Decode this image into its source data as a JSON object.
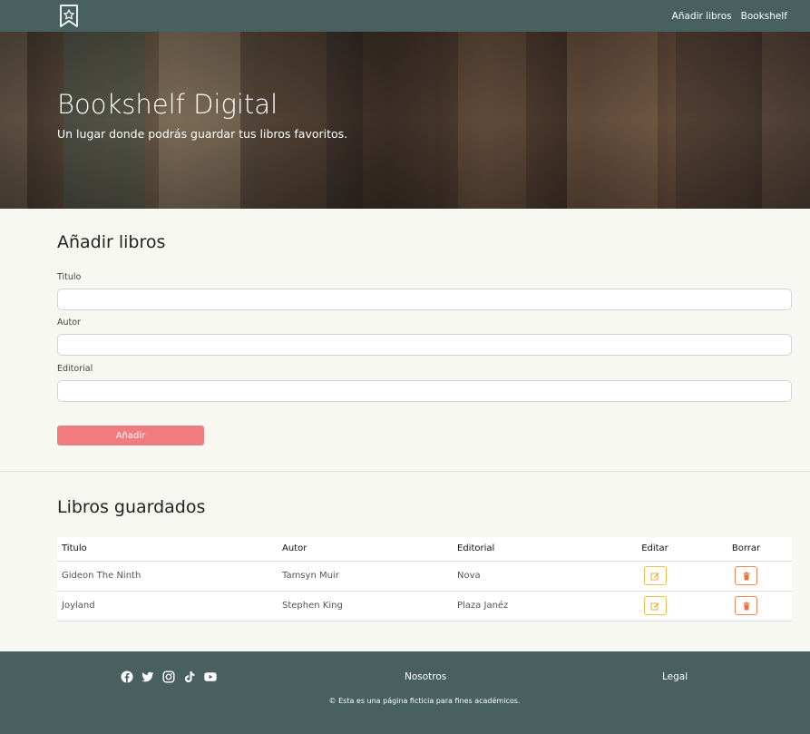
{
  "nav": {
    "logo_icon": "bookmark-star-icon",
    "links": [
      "Añadir libros",
      "Bookshelf"
    ]
  },
  "hero": {
    "title": "Bookshelf Digital",
    "subtitle": "Un lugar donde podrás guardar tus libros favoritos."
  },
  "form": {
    "title": "Añadir libros",
    "fields": [
      {
        "label": "Titulo",
        "value": ""
      },
      {
        "label": "Autor",
        "value": ""
      },
      {
        "label": "Editorial",
        "value": ""
      }
    ],
    "submit_label": "Añadir"
  },
  "books": {
    "title": "Libros guardados",
    "columns": [
      "Titulo",
      "Autor",
      "Editorial",
      "Editar",
      "Borrar"
    ],
    "rows": [
      {
        "title": "Gideon The Ninth",
        "author": "Tamsyn Muir",
        "publisher": "Nova"
      },
      {
        "title": "Joyland",
        "author": "Stephen King",
        "publisher": "Plaza Janéz"
      }
    ],
    "edit_icon": "pencil-square-icon",
    "delete_icon": "trash-icon"
  },
  "footer": {
    "social_icons": [
      "facebook-icon",
      "twitter-icon",
      "instagram-icon",
      "tiktok-icon",
      "youtube-icon"
    ],
    "about_label": "Nosotros",
    "legal_label": "Legal",
    "copyright": "© Esta es una página ficticia para fines académicos."
  },
  "colors": {
    "navbar": "#48605f",
    "page_bg": "#f8f8f2",
    "primary_button": "#f07c7f",
    "edit_border": "#f0c24b",
    "delete_border": "#ef8a55"
  }
}
